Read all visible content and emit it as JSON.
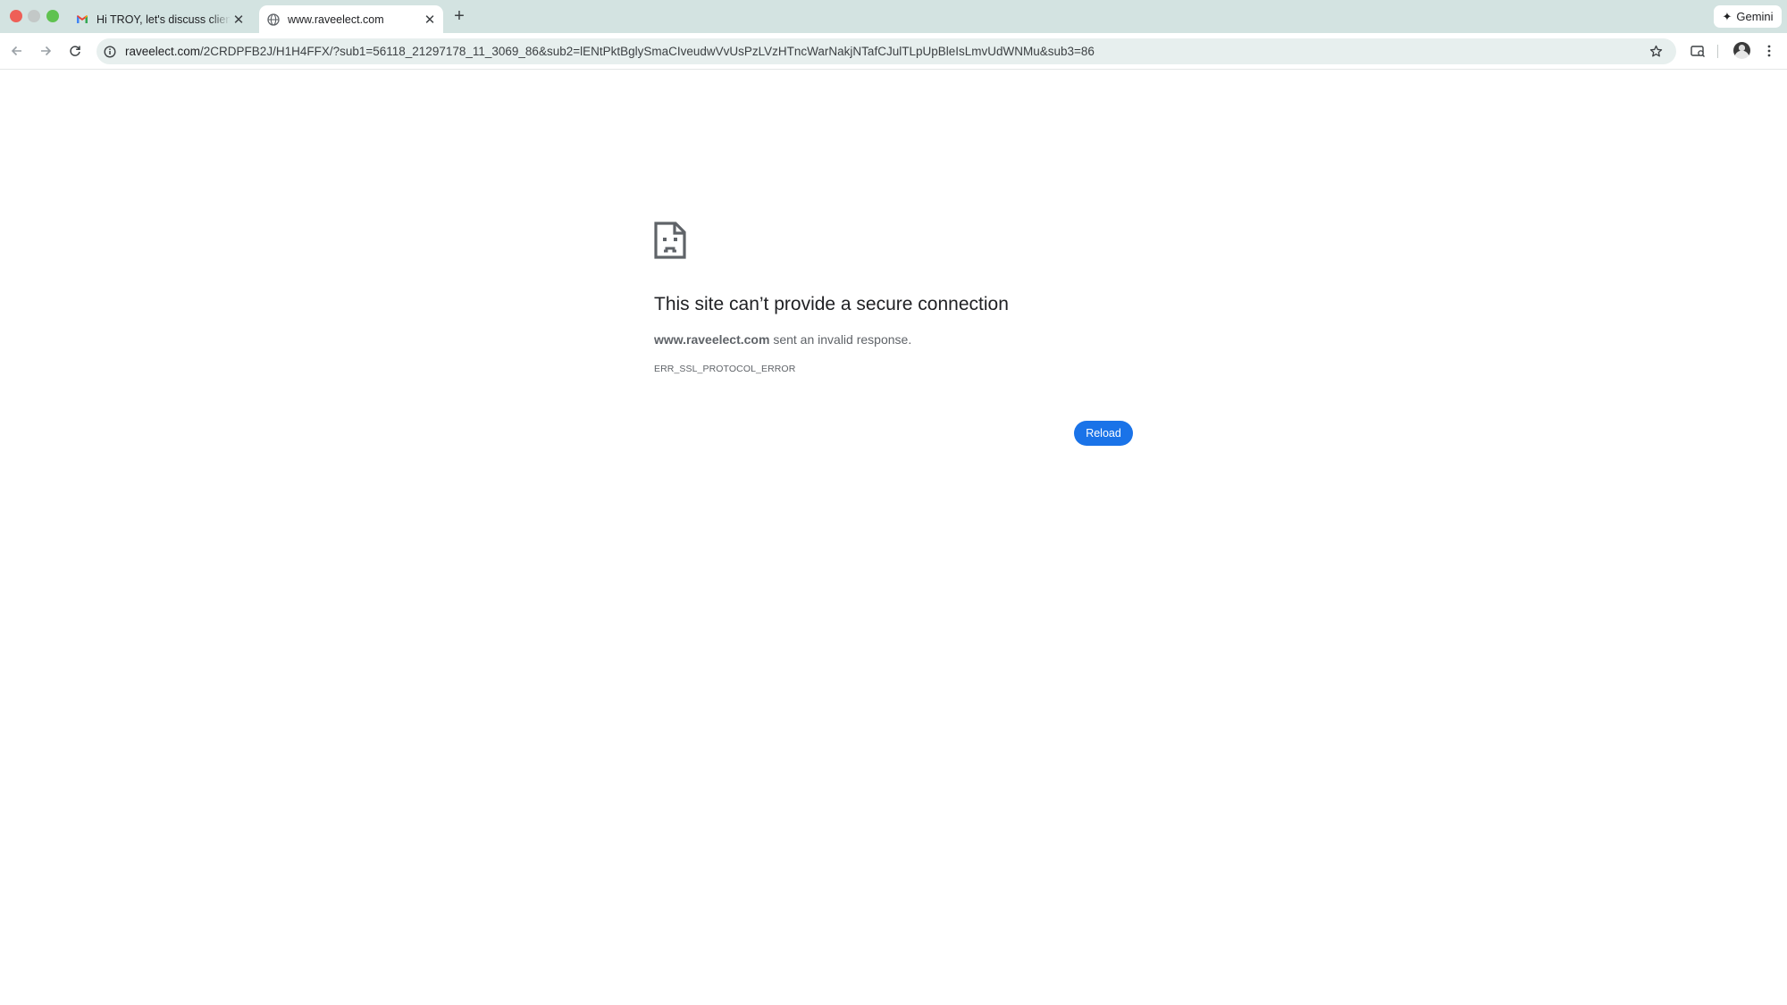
{
  "browser": {
    "tabs": [
      {
        "title": "Hi TROY, let's discuss client",
        "favicon": "gmail-icon",
        "active": false
      },
      {
        "title": "www.raveelect.com",
        "favicon": "globe-icon",
        "active": true
      }
    ],
    "gemini_label": "Gemini",
    "address_bar": {
      "host": "raveelect.com",
      "path": "/2CRDPFB2J/H1H4FFX/?sub1=56118_21297178_11_3069_86&sub2=lENtPktBglySmaCIveudwVvUsPzLVzHTncWarNakjNTafCJulTLpUpBleIsLmvUdWNMu&sub3=86"
    }
  },
  "error_page": {
    "icon": "sad-document-icon",
    "headline": "This site can’t provide a secure connection",
    "host": "www.raveelect.com",
    "message_suffix": " sent an invalid response.",
    "error_code": "ERR_SSL_PROTOCOL_ERROR",
    "reload_label": "Reload"
  },
  "colors": {
    "tabstrip": "#d3e3e1",
    "omnibox": "#e7efee",
    "button": "#1a73e8"
  }
}
